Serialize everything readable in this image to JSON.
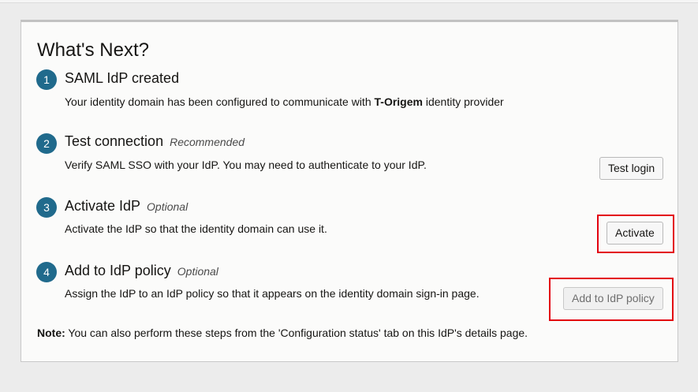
{
  "panel": {
    "title": "What's Next?",
    "steps": [
      {
        "number": "1",
        "title": "SAML IdP created",
        "tag": "",
        "description_prefix": "Your identity domain has been configured to communicate with ",
        "description_bold": "T-Origem",
        "description_suffix": " identity provider"
      },
      {
        "number": "2",
        "title": "Test connection",
        "tag": "Recommended",
        "description": "Verify SAML SSO with your IdP. You may need to authenticate to your IdP.",
        "button_label": "Test login"
      },
      {
        "number": "3",
        "title": "Activate IdP",
        "tag": "Optional",
        "description": "Activate the IdP so that the identity domain can use it.",
        "button_label": "Activate"
      },
      {
        "number": "4",
        "title": "Add to IdP policy",
        "tag": "Optional",
        "description": "Assign the IdP to an IdP policy so that it appears on the identity domain sign-in page.",
        "button_label": "Add to IdP policy"
      }
    ],
    "note_label": "Note:",
    "note_text": " You can also perform these steps from the 'Configuration status' tab on this IdP's details page."
  },
  "colors": {
    "step_badge": "#206a8c",
    "highlight": "#e3000f"
  }
}
